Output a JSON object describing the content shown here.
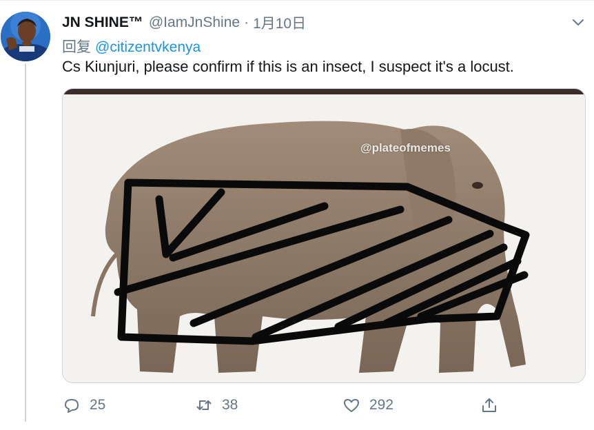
{
  "tweet": {
    "author_name": "JN SHINE™",
    "author_handle": "@IamJnShine",
    "separator": "·",
    "date": "1月10日",
    "reply_prefix": "回复",
    "reply_to": "@citizentvkenya",
    "text": "Cs Kiunjuri, please confirm if this is an insect, I suspect it's a locust.",
    "media": {
      "watermark": "@plateofmemes",
      "icon": "elephant-photo-with-black-scribbles"
    }
  },
  "actions": {
    "reply_count": "25",
    "retweet_count": "38",
    "like_count": "292"
  },
  "colors": {
    "text": "#14171a",
    "secondary": "#657786",
    "link": "#1b95e0",
    "border": "#ccd6dd"
  },
  "icons": {
    "caret": "chevron-down-icon",
    "reply": "speech-bubble-icon",
    "retweet": "retweet-icon",
    "like": "heart-icon",
    "share": "share-icon"
  }
}
